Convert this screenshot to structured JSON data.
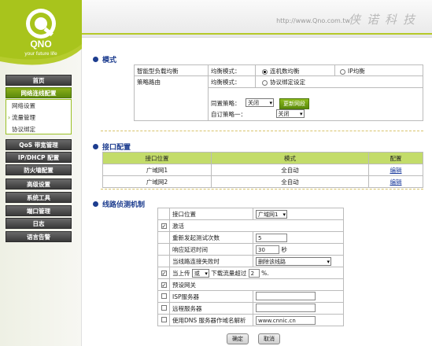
{
  "header": {
    "url": "http://www.Qno.com.tw",
    "brand_cn": "侠诺科技"
  },
  "logo": {
    "brand": "QNO",
    "slogan": "your future life"
  },
  "sidebar": {
    "items": [
      {
        "label": "首页"
      },
      {
        "label": "网络连线配置",
        "active": true
      },
      {
        "label": "QoS 带宽管理"
      },
      {
        "label": "IP/DHCP 配置"
      },
      {
        "label": "防火墙配置"
      },
      {
        "label": "高级设置"
      },
      {
        "label": "系统工具"
      },
      {
        "label": "端口管理"
      },
      {
        "label": "日志"
      },
      {
        "label": "语言告警"
      }
    ],
    "submenu": [
      {
        "label": "网络设置"
      },
      {
        "label": "流量管理",
        "active": true
      },
      {
        "label": "协议绑定"
      }
    ]
  },
  "mode": {
    "title": "模式",
    "row1_label": "智能型负载均衡",
    "row1_field": "均衡模式：",
    "opt_conn": "连机数均衡",
    "opt_ip": "IP均衡",
    "row2_label": "策略路由",
    "row2_field": "均衡模式：",
    "opt_proto": "协议绑定设定",
    "isp_label": "同置策略：",
    "isp_value": "关闭",
    "isp_btn": "更新网段",
    "custom_label": "自订策略一：",
    "custom_value": "关闭"
  },
  "ports": {
    "title": "接口配置",
    "headers": [
      "接口位置",
      "模式",
      "配置"
    ],
    "rows": [
      {
        "name": "广域网1",
        "mode": "全自动",
        "action": "编辑"
      },
      {
        "name": "广域网2",
        "mode": "全自动",
        "action": "编辑"
      }
    ]
  },
  "detect": {
    "title": "线路侦测机制",
    "port_label": "接口位置",
    "port_value": "广域网1",
    "enable_label": "激活",
    "retry_label": "重新发起测试次数",
    "retry_value": "5",
    "delay_label": "响应延迟时间",
    "delay_value": "30",
    "delay_unit": "秒",
    "action_label": "当线路连接失败时",
    "action_value": "删除该线路",
    "upload_label": "当上传",
    "upload_sel": "或",
    "download_label": "下载流量超过",
    "upload_value": "2",
    "upload_unit": "%.",
    "gateway_label": "预设网关",
    "isp_label": "ISP服务器",
    "remote_label": "远程服务器",
    "dns_label": "使用DNS 服务器作域名解析",
    "dns_value": "www.cnnic.cn"
  },
  "footer": {
    "apply": "确定",
    "cancel": "取消"
  }
}
